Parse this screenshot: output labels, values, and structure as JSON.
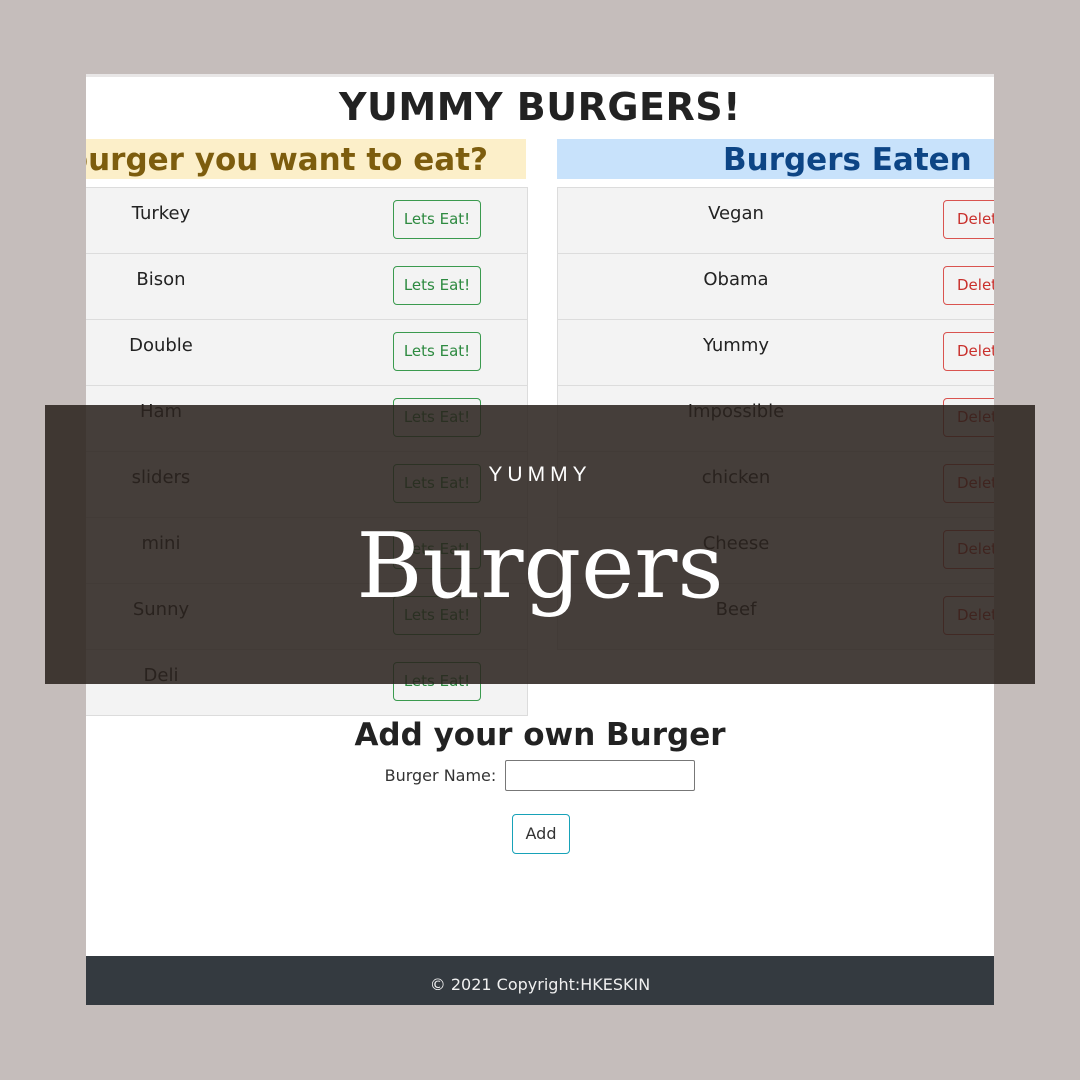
{
  "site": {
    "title": "YUMMY BURGERS!"
  },
  "uneaten": {
    "heading": "Which burger you want to eat?",
    "button_label": "Lets Eat!",
    "items": [
      "Turkey",
      "Bison",
      "Double",
      "Ham",
      "sliders",
      "mini",
      "Sunny",
      "Deli"
    ]
  },
  "eaten": {
    "heading": "Burgers Eaten",
    "button_label": "Delete",
    "items": [
      "Vegan",
      "Obama",
      "Yummy",
      "Impossible",
      "chicken",
      "Cheese",
      "Beef"
    ]
  },
  "add_form": {
    "heading": "Add your own Burger",
    "label": "Burger Name:",
    "input_value": "",
    "button_label": "Add"
  },
  "footer": {
    "text": "© 2021 Copyright:HKESKIN"
  },
  "banner": {
    "kicker": "YUMMY",
    "title": "Burgers"
  },
  "colors": {
    "page_background": "#c5bdbb",
    "eat_button": "#3a9a4e",
    "delete_button": "#d9534f",
    "footer_background": "#343a40"
  }
}
